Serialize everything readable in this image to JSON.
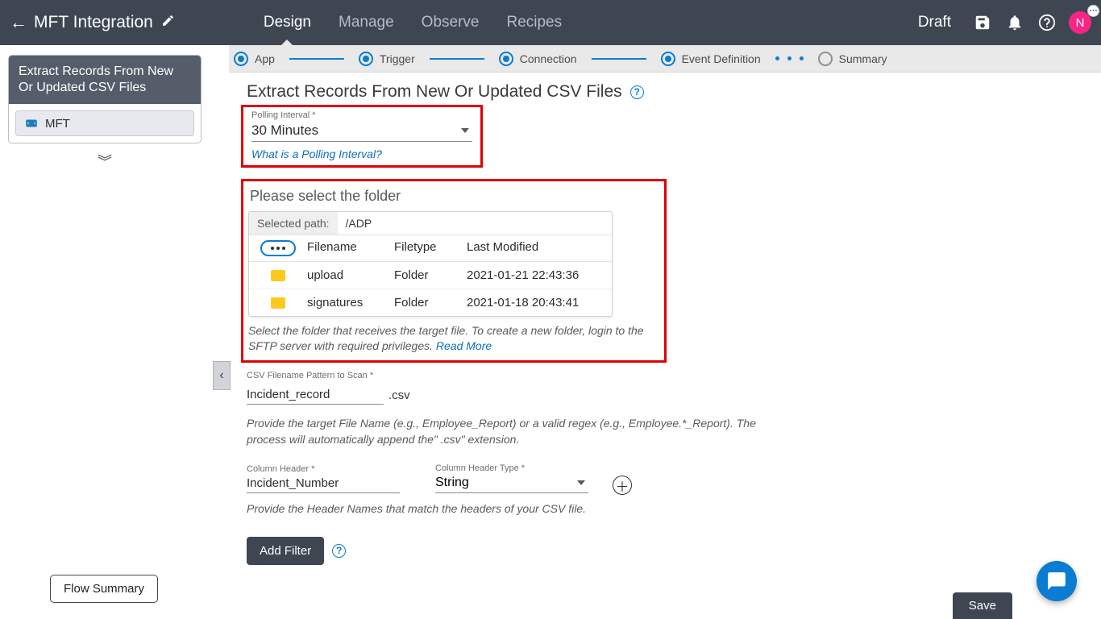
{
  "header": {
    "title": "MFT Integration",
    "tabs": [
      "Design",
      "Manage",
      "Observe",
      "Recipes"
    ],
    "active_tab": 0,
    "status": "Draft",
    "avatar_letter": "N"
  },
  "stepper": {
    "steps": [
      "App",
      "Trigger",
      "Connection",
      "Event Definition",
      "Summary"
    ],
    "active_index": 3
  },
  "sidebar": {
    "card_title": "Extract Records From New Or Updated CSV Files",
    "items": [
      {
        "label": "MFT"
      }
    ]
  },
  "page": {
    "title": "Extract Records From New Or Updated CSV Files"
  },
  "polling": {
    "label": "Polling Interval *",
    "value": "30 Minutes",
    "help_link": "What is a Polling Interval?"
  },
  "folder": {
    "section_title": "Please select the folder",
    "path_label": "Selected path:",
    "path_value": "/ADP",
    "columns": [
      "Filename",
      "Filetype",
      "Last Modified"
    ],
    "rows": [
      {
        "name": "upload",
        "type": "Folder",
        "modified": "2021-01-21 22:43:36"
      },
      {
        "name": "signatures",
        "type": "Folder",
        "modified": "2021-01-18 20:43:41"
      }
    ],
    "hint_pre": "Select the folder that receives the target file. To create a new folder, login to the SFTP server with required privileges. ",
    "hint_link": "Read More"
  },
  "filename": {
    "label": "CSV Filename Pattern to Scan *",
    "value": "Incident_record",
    "suffix": ".csv",
    "hint": "Provide the target File Name (e.g., Employee_Report) or a valid regex (e.g., Employee.*_Report). The process will automatically append the\" .csv\" extension."
  },
  "headers": {
    "col1_label": "Column Header *",
    "col1_value": "Incident_Number",
    "col2_label": "Column Header Type *",
    "col2_value": "String",
    "hint": "Provide the Header Names that match the headers of your CSV file."
  },
  "buttons": {
    "add_filter": "Add Filter",
    "flow_summary": "Flow Summary",
    "save": "Save"
  }
}
